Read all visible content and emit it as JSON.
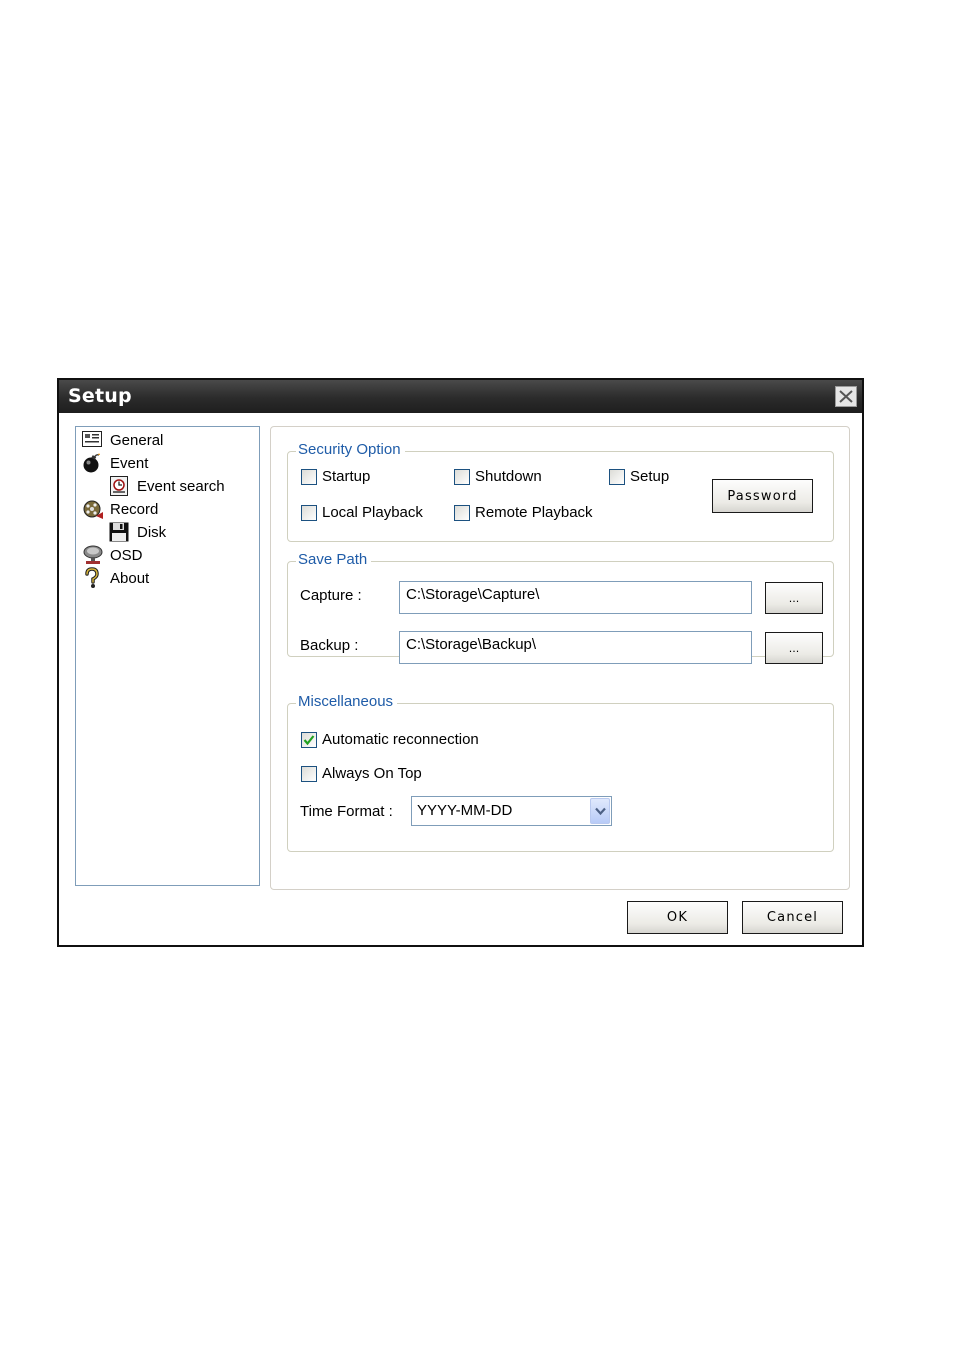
{
  "window": {
    "title": "Setup",
    "close_icon": "close-icon"
  },
  "tree": {
    "items": [
      {
        "label": "General",
        "icon": "general-icon"
      },
      {
        "label": "Event",
        "icon": "event-bomb-icon"
      },
      {
        "label": "Event search",
        "icon": "event-search-icon"
      },
      {
        "label": "Record",
        "icon": "record-film-icon"
      },
      {
        "label": "Disk",
        "icon": "floppy-disk-icon"
      },
      {
        "label": "OSD",
        "icon": "osd-monitor-icon"
      },
      {
        "label": "About",
        "icon": "question-icon"
      }
    ]
  },
  "security": {
    "title": "Security Option",
    "startup": {
      "label": "Startup",
      "checked": false
    },
    "shutdown": {
      "label": "Shutdown",
      "checked": false
    },
    "setup": {
      "label": "Setup",
      "checked": false
    },
    "local_playback": {
      "label": "Local Playback",
      "checked": false
    },
    "remote_playback": {
      "label": "Remote Playback",
      "checked": false
    },
    "password_button": "Password"
  },
  "save_path": {
    "title": "Save Path",
    "capture_label": "Capture :",
    "capture_value": "C:\\Storage\\Capture\\",
    "backup_label": "Backup :",
    "backup_value": "C:\\Storage\\Backup\\",
    "browse_label": "..."
  },
  "misc": {
    "title": "Miscellaneous",
    "auto_reconnect": {
      "label": "Automatic reconnection",
      "checked": true
    },
    "always_on_top": {
      "label": "Always On Top",
      "checked": false
    },
    "time_format_label": "Time Format :",
    "time_format_value": "YYYY-MM-DD"
  },
  "buttons": {
    "ok": "OK",
    "cancel": "Cancel"
  },
  "colors": {
    "group_title": "#1f5ca8",
    "titlebar": "#2b2b2b",
    "checkbox_border": "#1c5180",
    "check_mark": "#21a121"
  }
}
